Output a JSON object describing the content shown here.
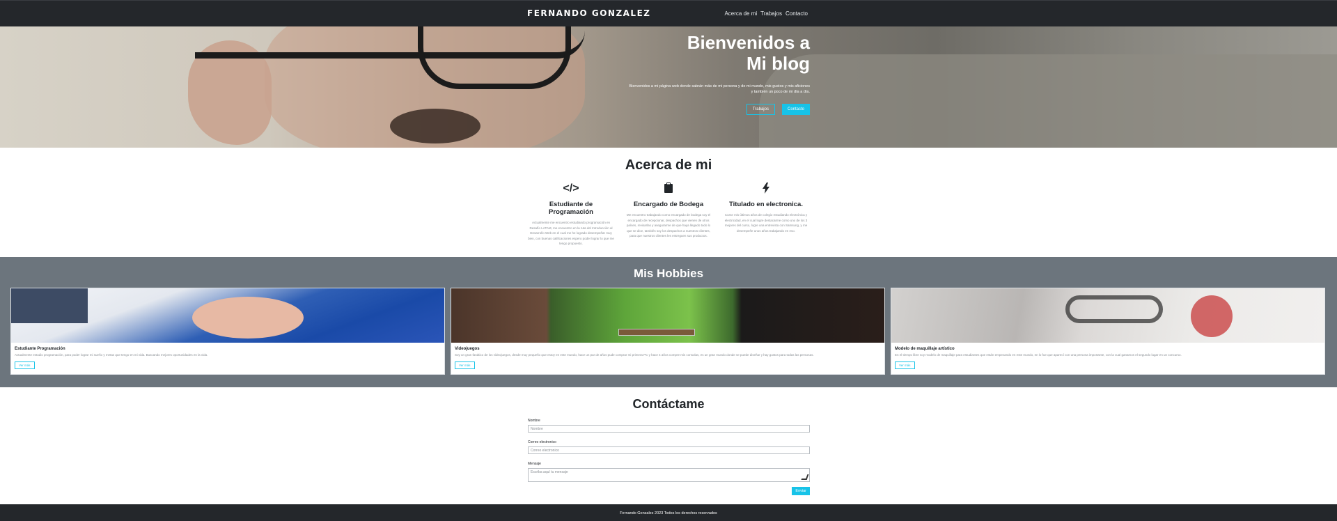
{
  "navbar": {
    "brand": "FERNANDO GONZALEZ",
    "links": [
      "Acerca de mi",
      "Trabajos",
      "Contacto"
    ]
  },
  "hero": {
    "title_line1": "Bienvenidos a",
    "title_line2": "Mi blog",
    "subtitle": "Bienvenidos a mi página web donde sabrán más de mi persona y de mi mundo, mis gustos y mis aficiones y también un poco de mi día a día.",
    "btn_trabajos": "Trabajos",
    "btn_contacto": "Contacto"
  },
  "about": {
    "title": "Acerca de mi",
    "items": [
      {
        "icon": "code-icon",
        "title": "Estudiante de Programación",
        "text": "Actualmente me encuentro estudiando programación en Desafío LATAM, me encuentro en la ruta del Introducción al Desarrollo Web en el cual me he logrado desempeñar muy bien, con buenas calificaciones espero poder lograr lo que me tengo propuesto."
      },
      {
        "icon": "clipboard-icon",
        "title": "Encargado de Bodega",
        "text": "Me encuentro trabajando como encargado de bodega soy el encargado de recepcionar, despachos que vienen de otros países, revisarlas y asegurarme de que haya llegado todo lo que se dice, también soy los despachos a nuestros clientes, para que nuestros clientes les entreguen sus productos."
      },
      {
        "icon": "bolt-icon",
        "title": "Titulado en electronica.",
        "text": "Curse mis últimos años de colegio estudiando electrónica y electricidad, en el cual logre destacarme como uno de los 3 mejores del curso, logre una entrevista con Samsung, y me desempeñe unos años trabajando en eso."
      }
    ]
  },
  "hobbies": {
    "title": "Mis Hobbies",
    "cards": [
      {
        "title": "Estudiante Programación",
        "text": "Actualmente estudio programación, para poder lograr mi sueño y metas que tengo en mi vida. Buscando mejores oportunidades en la vida.",
        "button": "Ver más"
      },
      {
        "title": "Videojuegos",
        "text": "Soy un gran fanático de los videojuegos, desde muy pequeño que estoy en este mundo, hace un par de años pude comprar mi primera PC y hace 4 años compre mis consolas, es un gran mundo donde se puede diseñar y hay gustos para todas las personas.",
        "button": "Ver más"
      },
      {
        "title": "Modelo de maquillaje artístico",
        "text": "En el tiempo libre soy modelo de maquillaje para estudiantes que están empezando en este mundo, en lo fue que aparecí con una persona importante, con la cual ganamos el segundo lugar en un concurso.",
        "button": "Ver más"
      }
    ]
  },
  "contact": {
    "title": "Contáctame",
    "name_label": "Nombre",
    "name_placeholder": "Nombre",
    "email_label": "Correo electronico",
    "email_placeholder": "Correo electronico",
    "message_label": "Mensaje",
    "message_placeholder": "Escriba aquí tu mensaje",
    "send": "Enviar"
  },
  "footer": {
    "text": "Fernando Gonzalez 2023 Todos los derechos reservados"
  },
  "colors": {
    "accent": "#17c3e8",
    "navbar_bg": "#24272b",
    "hobbies_bg": "#6c757d"
  }
}
